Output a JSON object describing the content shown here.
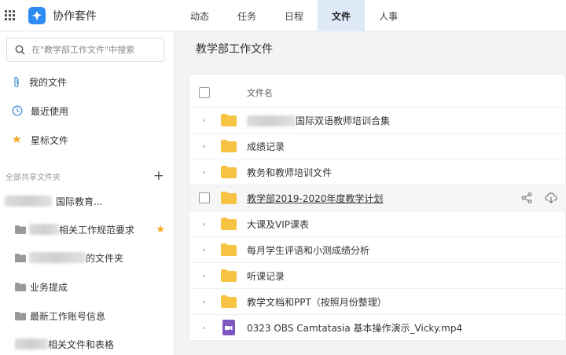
{
  "app": {
    "title": "协作套件"
  },
  "nav": {
    "tabs": [
      "动态",
      "任务",
      "日程",
      "文件",
      "人事"
    ],
    "active_index": 3
  },
  "sidebar": {
    "search_placeholder": "在\"教学部工作文件\"中搜索",
    "items": [
      {
        "label": "我的文件",
        "icon": "paperclip-icon"
      },
      {
        "label": "最近使用",
        "icon": "clock-icon"
      },
      {
        "label": "星标文件",
        "icon": "star-icon"
      }
    ],
    "shared_section_title": "全部共享文件夹",
    "tree": [
      {
        "label": "国际教育...",
        "starred": false
      },
      {
        "label": "相关工作规范要求",
        "starred": true
      },
      {
        "label": "的文件夹",
        "starred": false
      },
      {
        "label": "业务提成",
        "starred": false
      },
      {
        "label": "最新工作账号信息",
        "starred": false
      },
      {
        "label": "相关文件和表格",
        "starred": false
      }
    ]
  },
  "main": {
    "title": "教学部工作文件",
    "column_name_header": "文件名",
    "files": [
      {
        "name": "国际双语教师培训合集",
        "type": "folder"
      },
      {
        "name": "成绩记录",
        "type": "folder"
      },
      {
        "name": "教务和教师培训文件",
        "type": "folder"
      },
      {
        "name": "教学部2019-2020年度教学计划",
        "type": "folder",
        "hover": true
      },
      {
        "name": "大课及VIP课表",
        "type": "folder"
      },
      {
        "name": "每月学生评语和小测成绩分析",
        "type": "folder"
      },
      {
        "name": "听课记录",
        "type": "folder"
      },
      {
        "name": "教学文档和PPT（按照月份整理）",
        "type": "folder"
      },
      {
        "name": "0323 OBS Camtatasia 基本操作演示_Vicky.mp4",
        "type": "video"
      }
    ]
  },
  "colors": {
    "accent": "#2d8cf0",
    "folder": "#f6c342",
    "video": "#7e57c2",
    "star": "#f5a623",
    "active_tab_bg": "#dde9f6"
  }
}
